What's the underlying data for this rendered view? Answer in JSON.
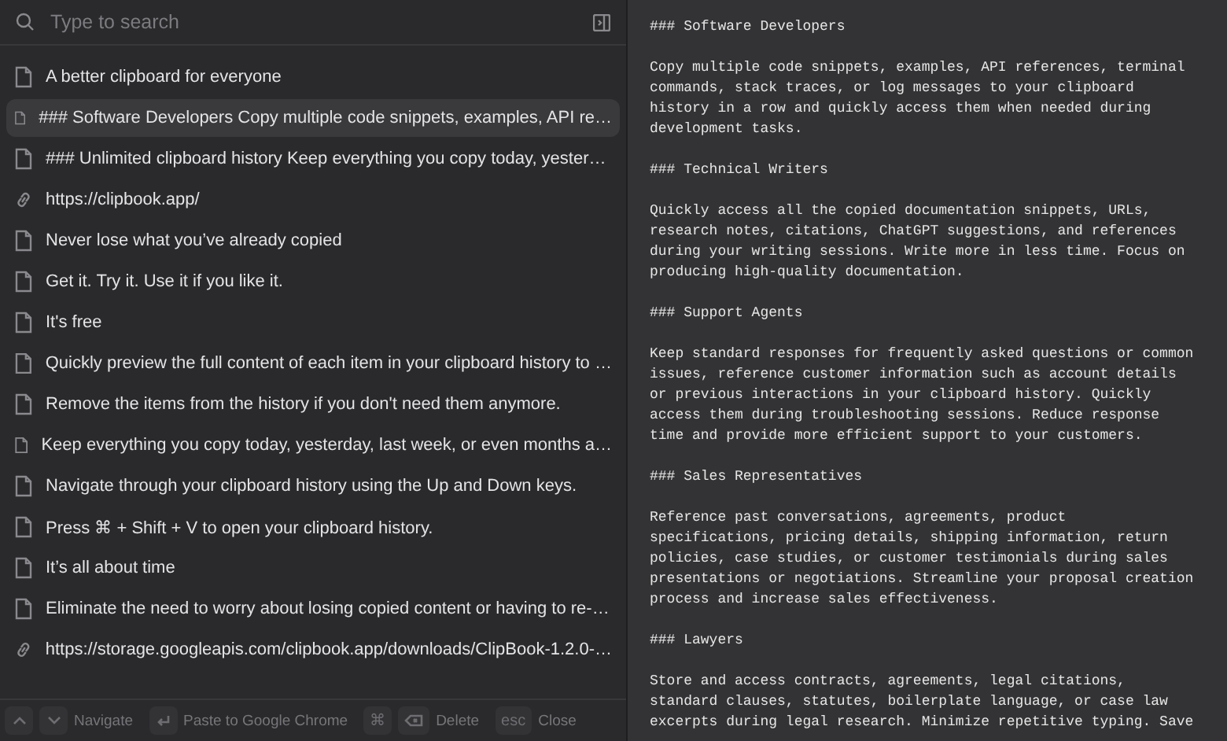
{
  "search": {
    "placeholder": "Type to search"
  },
  "items": [
    {
      "kind": "text",
      "label": "A better clipboard for everyone",
      "selected": false
    },
    {
      "kind": "text",
      "label": "### Software Developers Copy multiple code snippets, examples, API re…",
      "selected": true
    },
    {
      "kind": "text",
      "label": "### Unlimited clipboard history Keep everything you copy today, yester…",
      "selected": false
    },
    {
      "kind": "link",
      "label": "https://clipbook.app/",
      "selected": false
    },
    {
      "kind": "text",
      "label": "Never lose what you’ve already copied",
      "selected": false
    },
    {
      "kind": "text",
      "label": "Get it. Try it. Use it if you like it.",
      "selected": false
    },
    {
      "kind": "text",
      "label": "It's free",
      "selected": false
    },
    {
      "kind": "text",
      "label": "Quickly preview the full content of each item in your clipboard history to …",
      "selected": false
    },
    {
      "kind": "text",
      "label": "Remove the items from the history if you don't need them anymore.",
      "selected": false
    },
    {
      "kind": "text",
      "label": "Keep everything you copy today, yesterday, last week, or even months a…",
      "selected": false
    },
    {
      "kind": "text",
      "label": "Navigate through your clipboard history using the Up and Down keys.",
      "selected": false
    },
    {
      "kind": "text",
      "label": "Press ⌘ + Shift + V to open your clipboard history.",
      "selected": false
    },
    {
      "kind": "text",
      "label": "It’s all about time",
      "selected": false
    },
    {
      "kind": "text",
      "label": "Eliminate the need to worry about losing copied content or having to re-…",
      "selected": false
    },
    {
      "kind": "link",
      "label": "https://storage.googleapis.com/clipbook.app/downloads/ClipBook-1.2.0-…",
      "selected": false
    }
  ],
  "footer": [
    {
      "keys": [
        {
          "kind": "up"
        },
        {
          "kind": "down"
        }
      ],
      "label": "Navigate"
    },
    {
      "keys": [
        {
          "kind": "return"
        }
      ],
      "label": "Paste to Google Chrome"
    },
    {
      "keys": [
        {
          "kind": "char",
          "text": "⌘"
        },
        {
          "kind": "delete"
        }
      ],
      "label": "Delete"
    },
    {
      "keys": [
        {
          "kind": "char",
          "text": "esc"
        }
      ],
      "label": "Close"
    }
  ],
  "preview": [
    {
      "lines": [
        "### Software Developers"
      ]
    },
    {
      "lines": [
        "Copy multiple code snippets, examples, API references, terminal",
        "commands, stack traces, or log messages to your clipboard",
        "history in a row and quickly access them when needed during",
        "development tasks."
      ]
    },
    {
      "lines": [
        "### Technical Writers"
      ]
    },
    {
      "lines": [
        "Quickly access all the copied documentation snippets, URLs,",
        "research notes, citations, ChatGPT suggestions, and references",
        "during your writing sessions. Write more in less time. Focus on",
        "producing high-quality documentation."
      ]
    },
    {
      "lines": [
        "### Support Agents"
      ]
    },
    {
      "lines": [
        "Keep standard responses for frequently asked questions or common",
        "issues, reference customer information such as account details",
        "or previous interactions in your clipboard history. Quickly",
        "access them during troubleshooting sessions. Reduce response",
        "time and provide more efficient support to your customers."
      ]
    },
    {
      "lines": [
        "### Sales Representatives"
      ]
    },
    {
      "lines": [
        "Reference past conversations, agreements, product",
        "specifications, pricing details, shipping information, return",
        "policies, case studies, or customer testimonials during sales",
        "presentations or negotiations. Streamline your proposal creation",
        "process and increase sales effectiveness."
      ]
    },
    {
      "lines": [
        "### Lawyers"
      ]
    },
    {
      "lines": [
        "Store and access contracts, agreements, legal citations,",
        "standard clauses, statutes, boilerplate language, or case law",
        "excerpts during legal research. Minimize repetitive typing. Save"
      ]
    }
  ]
}
